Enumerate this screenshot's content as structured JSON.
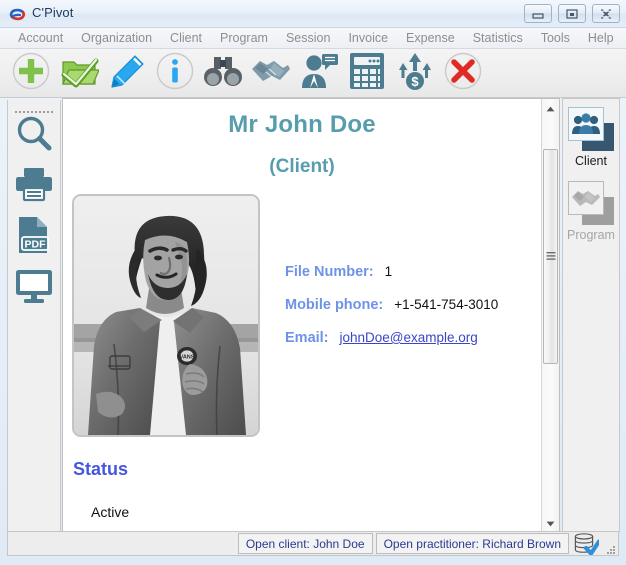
{
  "window": {
    "title": "C'Pivot",
    "logo_icon": "cpivot-logo-swirl",
    "buttons": {
      "minimize": "minimize-icon",
      "maximize": "maximize-icon",
      "close": "close-icon"
    }
  },
  "menubar": {
    "items": [
      {
        "label": "Account"
      },
      {
        "label": "Organization"
      },
      {
        "label": "Client"
      },
      {
        "label": "Program"
      },
      {
        "label": "Session"
      },
      {
        "label": "Invoice"
      },
      {
        "label": "Expense"
      },
      {
        "label": "Statistics"
      },
      {
        "label": "Tools"
      },
      {
        "label": "Help"
      }
    ]
  },
  "toolbar": {
    "items": [
      {
        "name": "add-icon",
        "title": "Add"
      },
      {
        "name": "open-folder-icon",
        "title": "Open"
      },
      {
        "name": "edit-pencil-icon",
        "title": "Edit"
      },
      {
        "name": "info-icon",
        "title": "Info"
      },
      {
        "name": "binoculars-icon",
        "title": "Search"
      },
      {
        "name": "handshake-icon",
        "title": "Program"
      },
      {
        "name": "person-chat-icon",
        "title": "Session"
      },
      {
        "name": "calculator-icon",
        "title": "Invoice"
      },
      {
        "name": "money-up-icon",
        "title": "Expense"
      },
      {
        "name": "delete-x-icon",
        "title": "Delete"
      }
    ]
  },
  "sidebar": {
    "items": [
      {
        "name": "magnifier-icon",
        "title": "Search"
      },
      {
        "name": "printer-icon",
        "title": "Print"
      },
      {
        "name": "pdf-icon",
        "title": "Export PDF"
      },
      {
        "name": "monitor-icon",
        "title": "Preview"
      }
    ]
  },
  "content": {
    "title": "Mr John Doe",
    "subtitle": "(Client)",
    "photo_alt": "Client photo",
    "fields": [
      {
        "label": "File Number:",
        "value": "1",
        "link": false
      },
      {
        "label": "Mobile phone:",
        "value": "+1-541-754-3010",
        "link": false
      },
      {
        "label": "Email:",
        "value": "johnDoe@example.org",
        "link": true
      }
    ],
    "status_section": {
      "heading": "Status",
      "value": "Active"
    }
  },
  "rightnav": {
    "items": [
      {
        "label": "Client",
        "icon": "clients-group-icon",
        "active": true
      },
      {
        "label": "Program",
        "icon": "handshake-icon",
        "active": false
      }
    ]
  },
  "statusbar": {
    "open_client": "Open client: John Doe",
    "open_practitioner": "Open practitioner: Richard Brown",
    "db_icon": "database-ok-icon"
  },
  "colors": {
    "accent_teal": "#579dab",
    "field_label_blue": "#6d93e8",
    "section_blue": "#4457dd",
    "link_blue": "#3a46c8",
    "status_text": "#2b3a8f",
    "toolbar_icon": "#4d7c91"
  }
}
